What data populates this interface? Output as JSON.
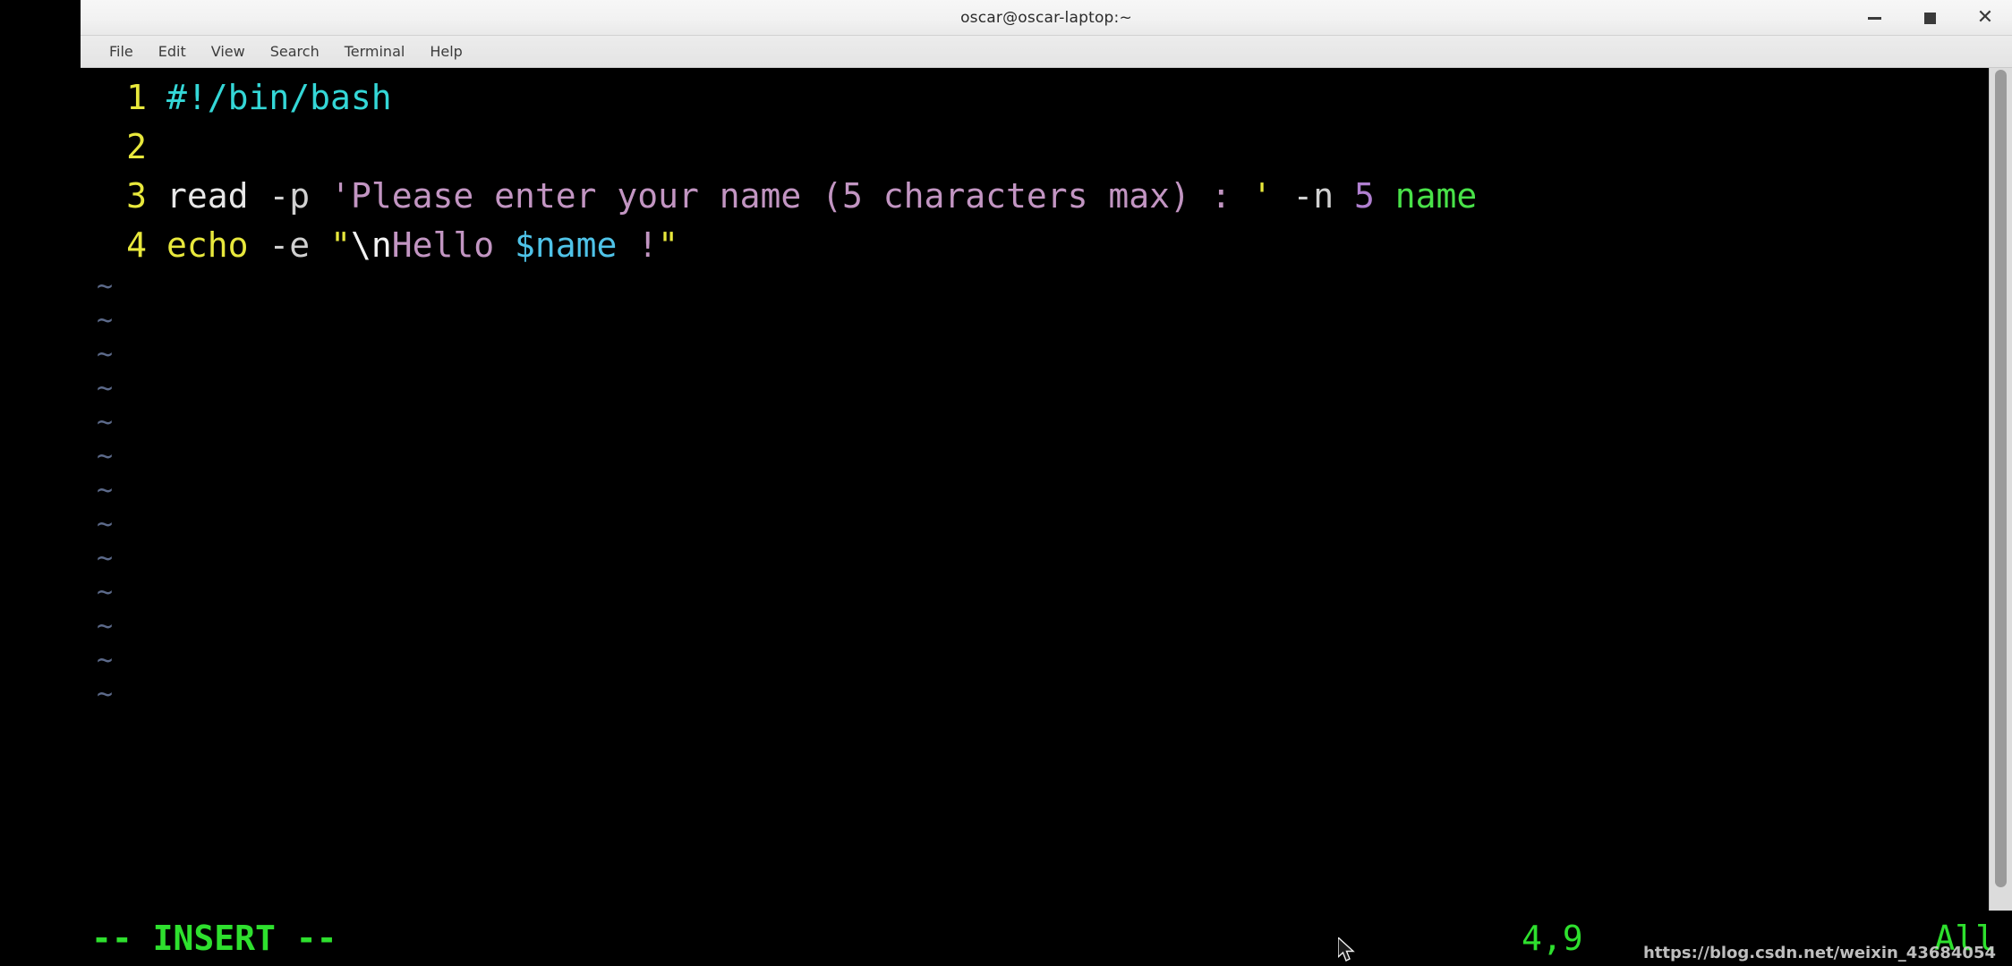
{
  "window": {
    "title": "oscar@oscar-laptop:~",
    "controls": {
      "minimize_label": "—",
      "maximize_label": "■",
      "close_label": "✕"
    }
  },
  "menubar": {
    "items": [
      {
        "label": "File"
      },
      {
        "label": "Edit"
      },
      {
        "label": "View"
      },
      {
        "label": "Search"
      },
      {
        "label": "Terminal"
      },
      {
        "label": "Help"
      }
    ]
  },
  "editor": {
    "lines": [
      {
        "number": "1",
        "tokens": [
          {
            "text": "#!/bin/bash",
            "cls": "c-comment"
          }
        ]
      },
      {
        "number": "2",
        "tokens": []
      },
      {
        "number": "3",
        "tokens": [
          {
            "text": "read",
            "cls": "c-plain"
          },
          {
            "text": " ",
            "cls": "c-plain"
          },
          {
            "text": "-p",
            "cls": "c-flag"
          },
          {
            "text": " ",
            "cls": "c-plain"
          },
          {
            "text": "'Please enter your name (5 characters max) : ",
            "cls": "c-string"
          },
          {
            "text": "'",
            "cls": "c-quote"
          },
          {
            "text": " ",
            "cls": "c-plain"
          },
          {
            "text": "-n",
            "cls": "c-flag"
          },
          {
            "text": " ",
            "cls": "c-plain"
          },
          {
            "text": "5",
            "cls": "c-number"
          },
          {
            "text": " ",
            "cls": "c-plain"
          },
          {
            "text": "name",
            "cls": "c-var"
          }
        ]
      },
      {
        "number": "4",
        "tokens": [
          {
            "text": "echo",
            "cls": "c-kw"
          },
          {
            "text": " ",
            "cls": "c-plain"
          },
          {
            "text": "-e",
            "cls": "c-flag"
          },
          {
            "text": " ",
            "cls": "c-plain"
          },
          {
            "text": "\"",
            "cls": "c-quote"
          },
          {
            "text": "\\n",
            "cls": "c-esc"
          },
          {
            "text": "Hello ",
            "cls": "c-string"
          },
          {
            "text": "$name",
            "cls": "c-cyanvar"
          },
          {
            "text": " ",
            "cls": "c-plain"
          },
          {
            "text": "!",
            "cls": "c-bang"
          },
          {
            "text": "\"",
            "cls": "c-quote"
          }
        ]
      }
    ],
    "empty_marker": "~",
    "empty_marker_count": 13,
    "raw_text": [
      "#!/bin/bash",
      "",
      "read -p 'Please enter your name (5 characters max) : ' -n 5 name",
      "echo -e \"\\nHello $name !\""
    ]
  },
  "statusbar": {
    "mode": "-- INSERT --",
    "cursor_position": "4,9",
    "scroll_indicator": "All"
  },
  "watermark": {
    "text": "https://blog.csdn.net/weixin_43684054"
  },
  "colors": {
    "terminal_background": "#000000",
    "titlebar_background": "#f2f2f2",
    "menubar_background": "#e8e8e8",
    "line_number": "#e8e83c",
    "comment": "#34d7d7",
    "string": "#c295c2",
    "quote": "#e8e83c",
    "number": "#b07fd0",
    "variable_green": "#49e249",
    "variable_cyan": "#4fc3e8",
    "status_green": "#2ee02e",
    "tilde": "#5c6a8a",
    "scrollbar_track": "#dcdcdc",
    "scrollbar_thumb": "#9a9a9a"
  }
}
